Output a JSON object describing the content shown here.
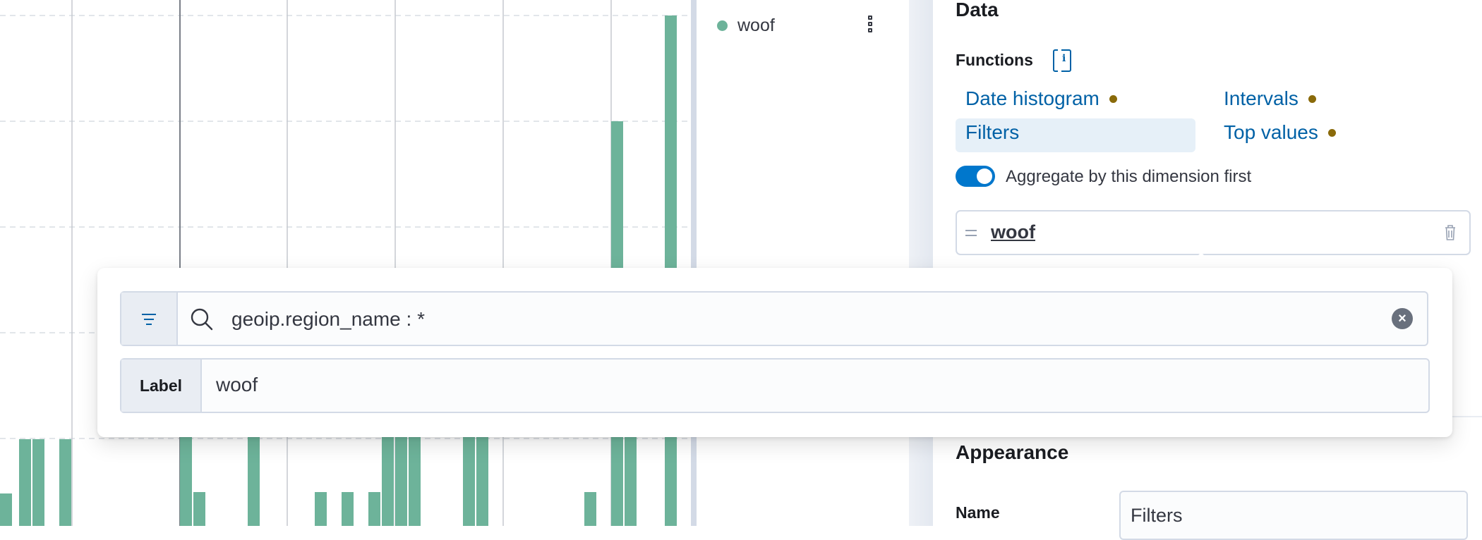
{
  "chart": {
    "legend_label": "woof",
    "series_color": "#6DB39A"
  },
  "panel": {
    "section_title": "Data",
    "functions_label": "Functions",
    "functions": [
      {
        "label": "Date histogram",
        "warning": true
      },
      {
        "label": "Intervals",
        "warning": true
      },
      {
        "label": "Filters",
        "warning": false,
        "selected": true
      },
      {
        "label": "Top values",
        "warning": true
      }
    ],
    "toggle_label": "Aggregate by this dimension first",
    "toggle_on": true,
    "filter_item_label": "woof",
    "appearance_title": "Appearance",
    "name_label": "Name",
    "name_value": "Filters"
  },
  "popover": {
    "query": "geoip.region_name : *",
    "label_prepend": "Label",
    "label_value": "woof"
  },
  "colors": {
    "link": "#0061a6",
    "warning_dot": "#8a6a0a",
    "accent": "#0077cc"
  }
}
